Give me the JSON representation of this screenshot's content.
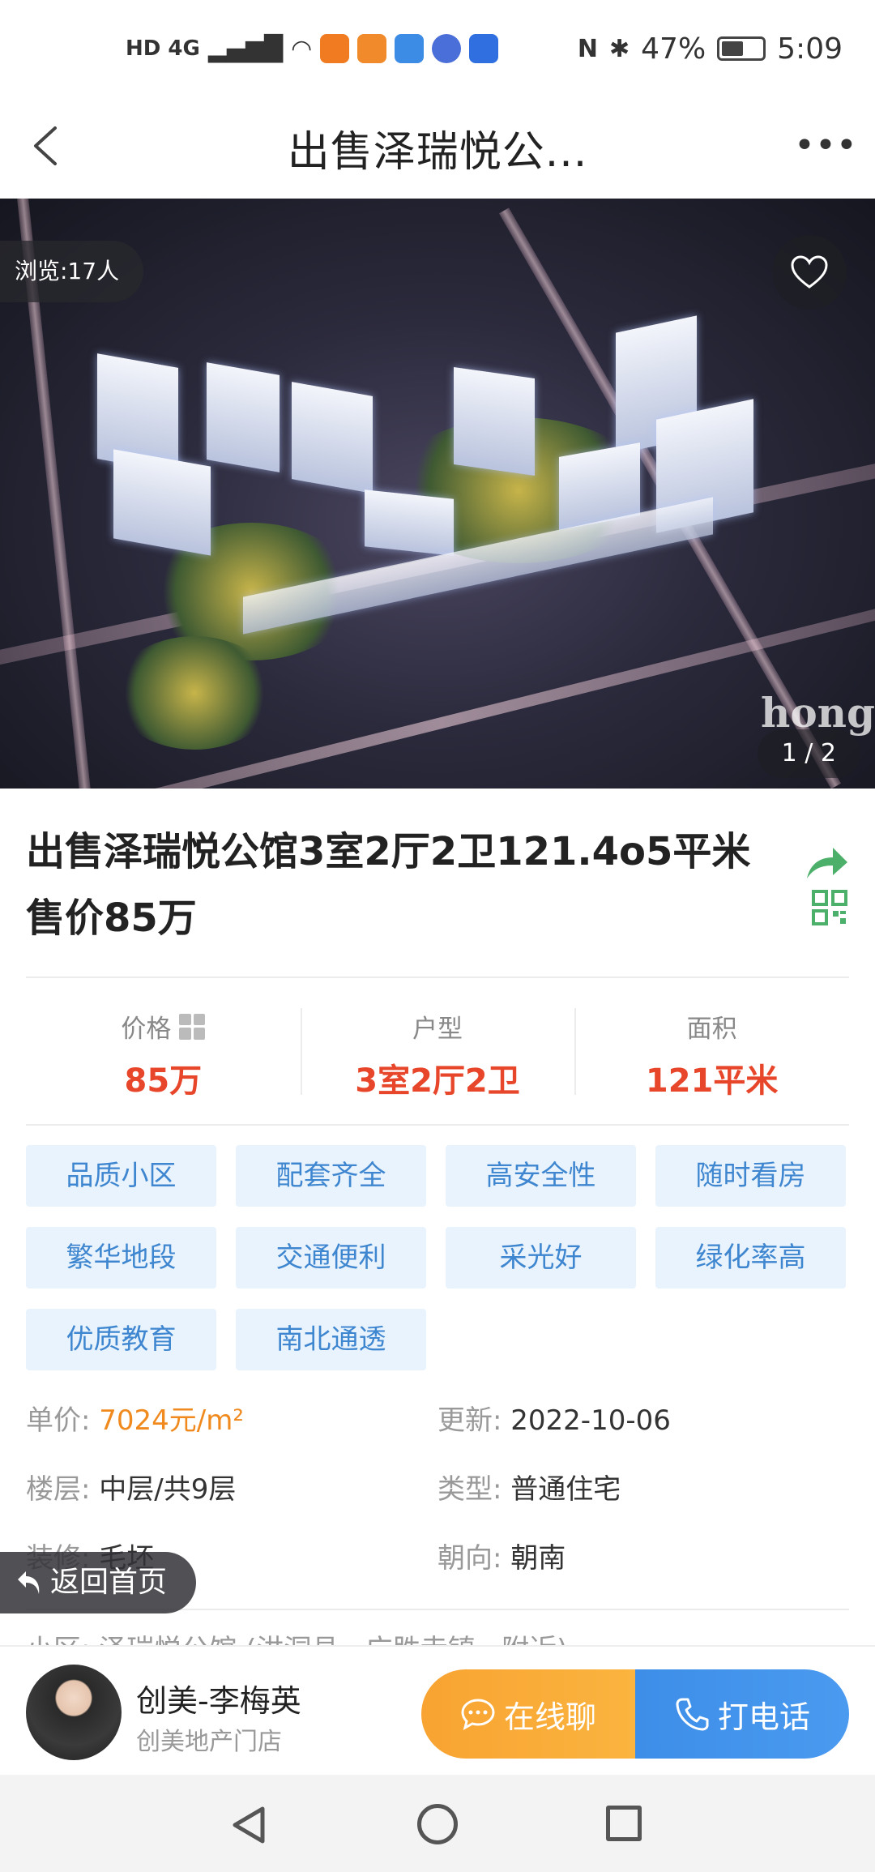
{
  "status_bar": {
    "left_text": "HD 4G",
    "battery": "47%",
    "time": "5:09"
  },
  "nav": {
    "title": "出售泽瑞悦公..."
  },
  "hero": {
    "view_count": "浏览:17人",
    "watermark": "hong",
    "counter": "1 / 2"
  },
  "listing": {
    "title": "出售泽瑞悦公馆3室2厅2卫121.4o5平米售价85万"
  },
  "facts": [
    {
      "label": "价格",
      "value": "85万"
    },
    {
      "label": "户型",
      "value": "3室2厅2卫"
    },
    {
      "label": "面积",
      "value": "121平米"
    }
  ],
  "tags": [
    "品质小区",
    "配套齐全",
    "高安全性",
    "随时看房",
    "繁华地段",
    "交通便利",
    "采光好",
    "绿化率高",
    "优质教育",
    "南北通透"
  ],
  "details": {
    "unit_price_label": "单价:",
    "unit_price": "7024元/m²",
    "updated_label": "更新:",
    "updated": "2022-10-06",
    "floor_label": "楼层:",
    "floor": "中层/共9层",
    "type_label": "类型:",
    "type": "普通住宅",
    "decor_label": "装修:",
    "decor": "毛坯",
    "orientation_label": "朝向:",
    "orientation": "朝南"
  },
  "home_button": "返回首页",
  "peek_text": "小区: 泽瑞悦公馆 (洪洞县 · 广胜寺镇 · 附近)",
  "agent": {
    "name": "创美-李梅英",
    "store": "创美地产门店",
    "chat_label": "在线聊",
    "call_label": "打电话"
  },
  "colors": {
    "price_red": "#e8462a",
    "tag_blue": "#3e86cf",
    "tag_bg": "#e9f3fd",
    "unit_price_orange": "#f08a1e",
    "chat_orange": "#f8a332",
    "call_blue": "#3d8ee8",
    "share_green": "#4cb06a"
  }
}
